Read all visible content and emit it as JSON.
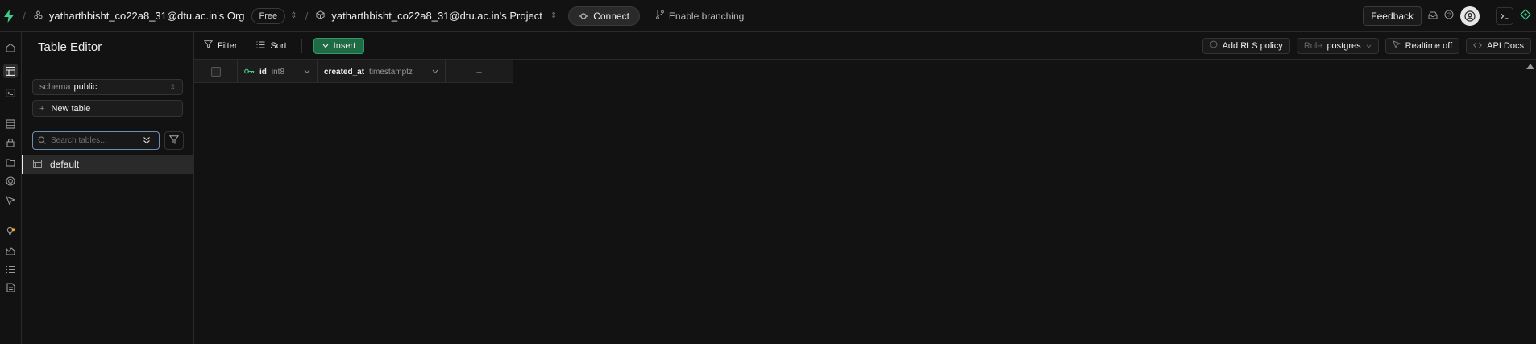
{
  "topbar": {
    "org_name": "yatharthbisht_co22a8_31@dtu.ac.in's Org",
    "plan_badge": "Free",
    "project_name": "yatharthbisht_co22a8_31@dtu.ac.in's Project",
    "connect_label": "Connect",
    "branching_label": "Enable branching",
    "feedback_label": "Feedback"
  },
  "sidebar": {
    "title": "Table Editor",
    "schema_label": "schema",
    "schema_value": "public",
    "new_table_label": "New table",
    "search_placeholder": "Search tables...",
    "tables": [
      {
        "name": "default"
      }
    ]
  },
  "toolbar": {
    "filter_label": "Filter",
    "sort_label": "Sort",
    "insert_label": "Insert",
    "rls_label": "Add RLS policy",
    "role_label": "Role",
    "role_value": "postgres",
    "realtime_label": "Realtime off",
    "api_docs_label": "API Docs"
  },
  "grid": {
    "columns": [
      {
        "name": "id",
        "type": "int8",
        "primary_key": true
      },
      {
        "name": "created_at",
        "type": "timestamptz",
        "primary_key": false
      }
    ],
    "add_column_symbol": "+"
  },
  "colors": {
    "background": "#121212",
    "brand_green": "#3ecf8e",
    "insert_green": "#1f6b45",
    "focus_border": "#6b8fb5",
    "notification_dot": "#f5a623"
  }
}
